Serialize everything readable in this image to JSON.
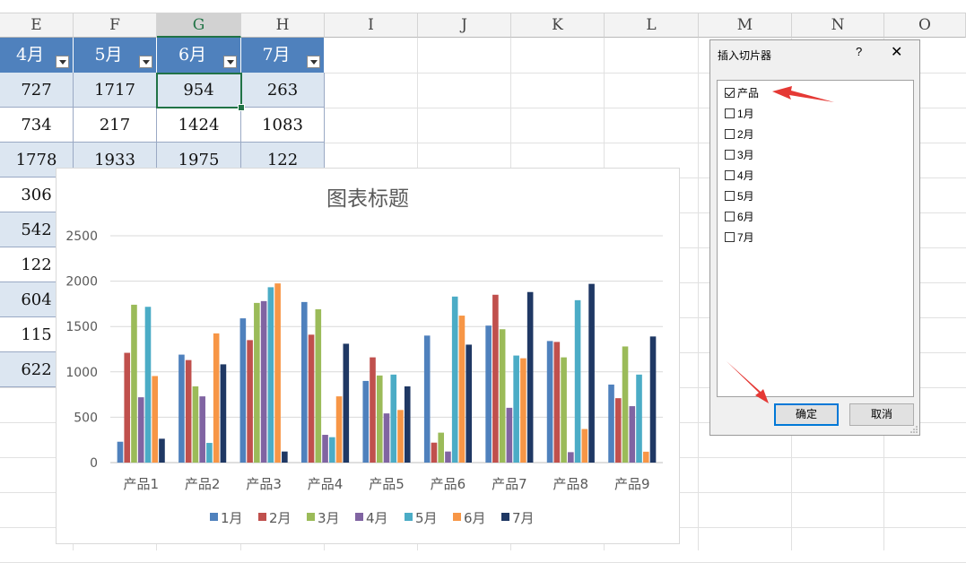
{
  "sheet": {
    "columns": [
      "E",
      "F",
      "G",
      "H",
      "I",
      "J",
      "K",
      "L",
      "M",
      "N",
      "O"
    ],
    "selected_column": "G",
    "table": {
      "headers": [
        "4月",
        "5月",
        "6月",
        "7月"
      ],
      "rows": [
        [
          "727",
          "1717",
          "954",
          "263"
        ],
        [
          "734",
          "217",
          "1424",
          "1083"
        ],
        [
          "1778",
          "1933",
          "1975",
          "122"
        ],
        [
          "306"
        ],
        [
          "542"
        ],
        [
          "122"
        ],
        [
          "604"
        ],
        [
          "115"
        ],
        [
          "622"
        ]
      ]
    }
  },
  "chart_data": {
    "type": "bar",
    "title": "图表标题",
    "categories": [
      "产品1",
      "产品2",
      "产品3",
      "产品4",
      "产品5",
      "产品6",
      "产品7",
      "产品8",
      "产品9"
    ],
    "ylim": [
      0,
      2500
    ],
    "yticks": [
      0,
      500,
      1000,
      1500,
      2000,
      2500
    ],
    "grid": true,
    "legend_position": "bottom",
    "series": [
      {
        "name": "1月",
        "color": "#4f81bd",
        "values": [
          230,
          1190,
          1590,
          1770,
          900,
          1400,
          1510,
          1340,
          860
        ]
      },
      {
        "name": "2月",
        "color": "#c0504d",
        "values": [
          1210,
          1130,
          1350,
          1410,
          1160,
          220,
          1850,
          1330,
          710
        ]
      },
      {
        "name": "3月",
        "color": "#9bbb59",
        "values": [
          1740,
          840,
          1760,
          1690,
          960,
          330,
          1470,
          1160,
          1280
        ]
      },
      {
        "name": "4月",
        "color": "#8064a2",
        "values": [
          720,
          730,
          1780,
          306,
          542,
          122,
          604,
          115,
          622
        ]
      },
      {
        "name": "5月",
        "color": "#4bacc6",
        "values": [
          1717,
          217,
          1933,
          280,
          970,
          1830,
          1180,
          1790,
          970
        ]
      },
      {
        "name": "6月",
        "color": "#f79646",
        "values": [
          954,
          1424,
          1975,
          730,
          580,
          1620,
          1150,
          370,
          120
        ]
      },
      {
        "name": "7月",
        "color": "#1f3864",
        "values": [
          263,
          1083,
          122,
          1310,
          840,
          1300,
          1880,
          1970,
          1390
        ]
      }
    ]
  },
  "dialog": {
    "title": "插入切片器",
    "help": "?",
    "close": "✕",
    "items": [
      {
        "label": "产品",
        "checked": true
      },
      {
        "label": "1月",
        "checked": false
      },
      {
        "label": "2月",
        "checked": false
      },
      {
        "label": "3月",
        "checked": false
      },
      {
        "label": "4月",
        "checked": false
      },
      {
        "label": "5月",
        "checked": false
      },
      {
        "label": "6月",
        "checked": false
      },
      {
        "label": "7月",
        "checked": false
      }
    ],
    "ok_label": "确定",
    "cancel_label": "取消"
  }
}
